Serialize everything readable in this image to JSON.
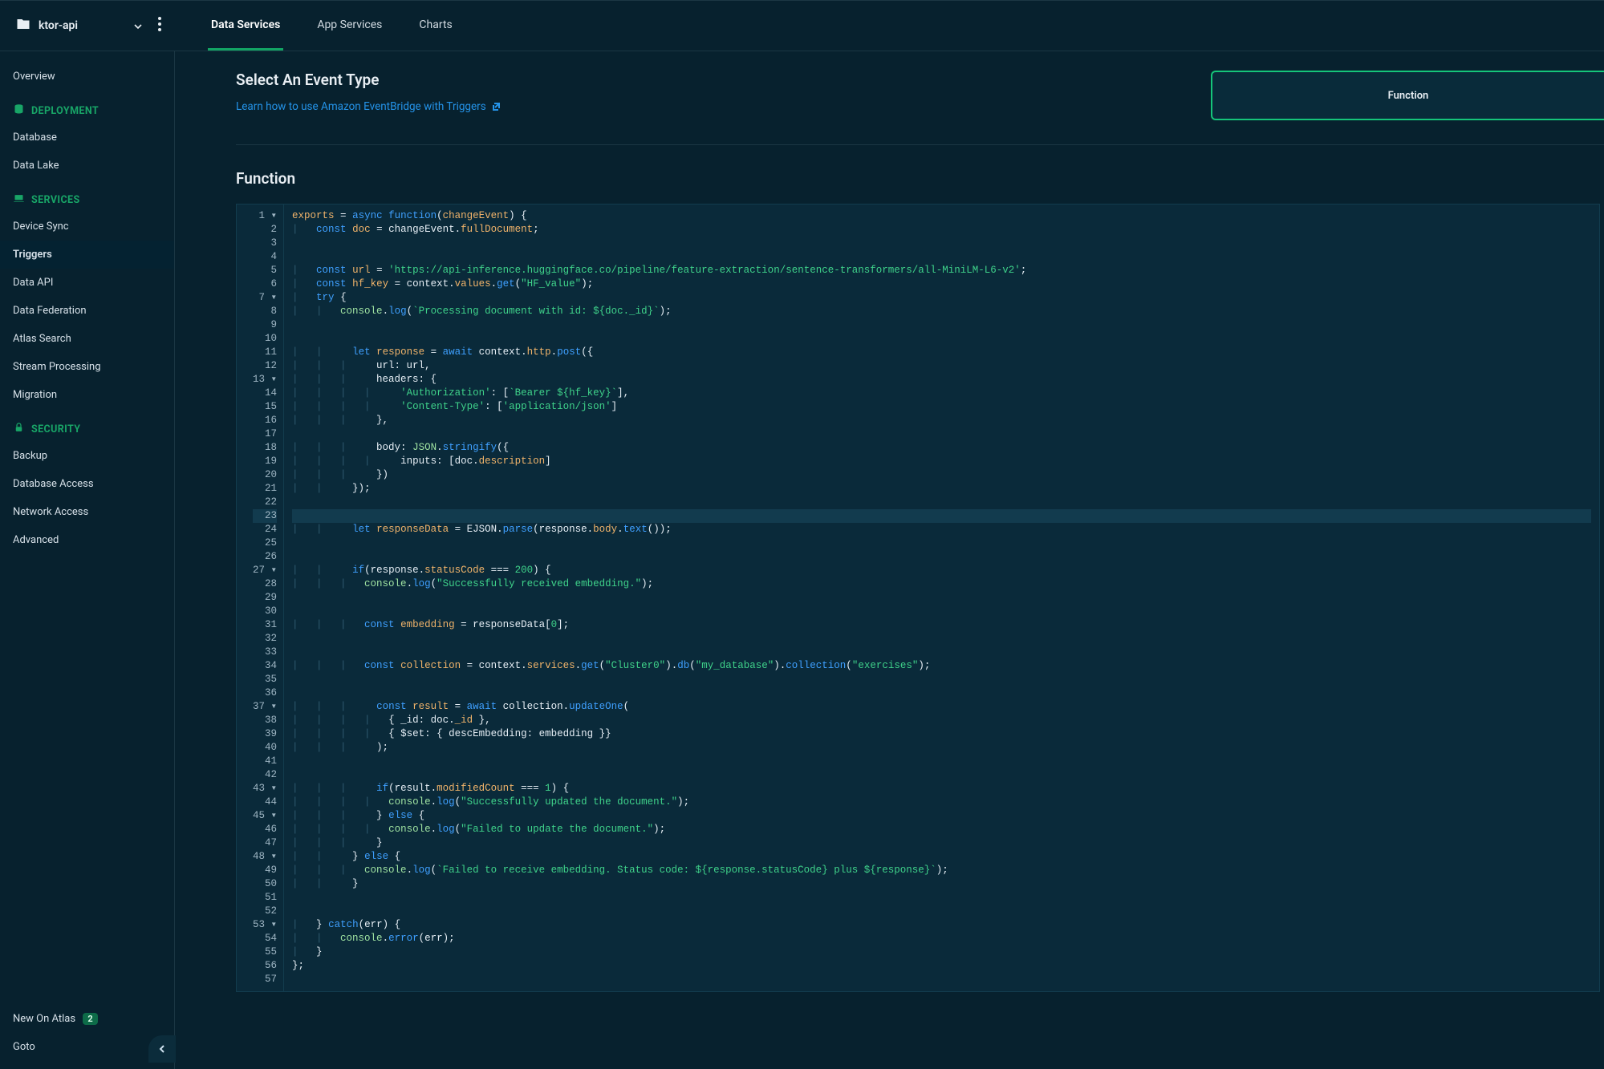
{
  "project": {
    "name": "ktor-api"
  },
  "tabs": [
    {
      "label": "Data Services",
      "active": true
    },
    {
      "label": "App Services",
      "active": false
    },
    {
      "label": "Charts",
      "active": false
    }
  ],
  "sidebar": {
    "top": {
      "overview": "Overview"
    },
    "deployment": {
      "header": "DEPLOYMENT",
      "items": [
        {
          "key": "database",
          "label": "Database"
        },
        {
          "key": "data-lake",
          "label": "Data Lake"
        }
      ]
    },
    "services": {
      "header": "SERVICES",
      "items": [
        {
          "key": "device-sync",
          "label": "Device Sync"
        },
        {
          "key": "triggers",
          "label": "Triggers",
          "active": true
        },
        {
          "key": "data-api",
          "label": "Data API"
        },
        {
          "key": "data-federation",
          "label": "Data Federation"
        },
        {
          "key": "atlas-search",
          "label": "Atlas Search"
        },
        {
          "key": "stream-processing",
          "label": "Stream Processing"
        },
        {
          "key": "migration",
          "label": "Migration"
        }
      ]
    },
    "security": {
      "header": "SECURITY",
      "items": [
        {
          "key": "backup",
          "label": "Backup"
        },
        {
          "key": "database-access",
          "label": "Database Access"
        },
        {
          "key": "network-access",
          "label": "Network Access"
        },
        {
          "key": "advanced",
          "label": "Advanced"
        }
      ]
    },
    "bottom": {
      "new": {
        "label": "New On Atlas",
        "badge": "2"
      },
      "goto": {
        "label": "Goto"
      }
    }
  },
  "event": {
    "heading": "Select An Event Type",
    "learn": "Learn how to use Amazon EventBridge with Triggers",
    "card": "Function"
  },
  "function": {
    "heading": "Function"
  },
  "code": {
    "url_string": "'https://api-inference.huggingface.co/pipeline/feature-extraction/sentence-transformers/all-MiniLM-L6-v2'",
    "hf_value": "\"HF_value\"",
    "processing_msg": "`Processing document with id: ${doc._id}`",
    "auth_header": "'Authorization'",
    "bearer": "`Bearer ${hf_key}`",
    "ct_header": "'Content-Type'",
    "ct_value": "'application/json'",
    "status_ok": "200",
    "success_embed": "\"Successfully received embedding.\"",
    "zero": "0",
    "cluster": "\"Cluster0\"",
    "db": "\"my_database\"",
    "collection": "\"exercises\"",
    "one": "1",
    "success_update": "\"Successfully updated the document.\"",
    "fail_update": "\"Failed to update the document.\"",
    "fail_embed": "`Failed to receive embedding. Status code: ${response.statusCode} plus ${response}`",
    "line_count": 57,
    "highlight_line": 23
  }
}
